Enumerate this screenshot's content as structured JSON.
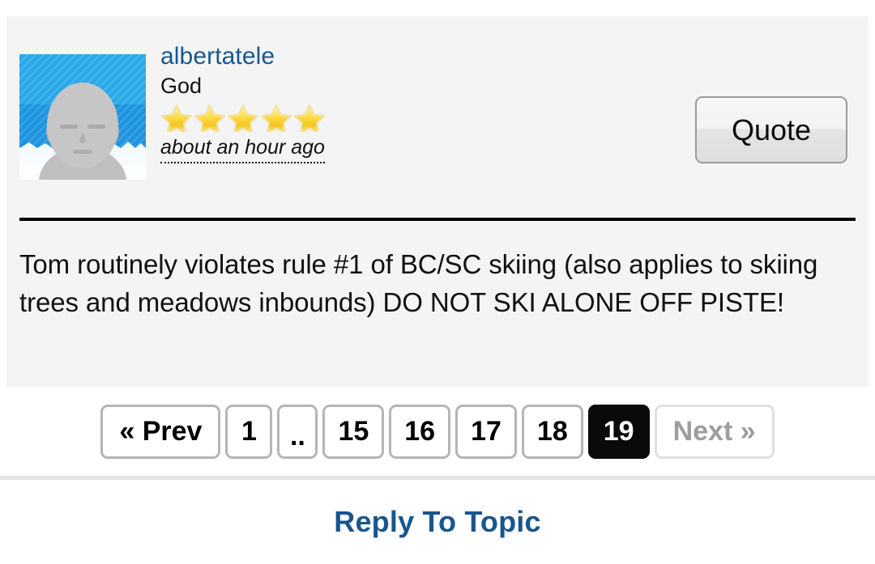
{
  "post": {
    "author": "albertatele",
    "rank": "God",
    "star_count": 5,
    "timestamp": "about an hour ago",
    "quote_label": "Quote",
    "body": "Tom routinely violates rule #1 of BC/SC skiing (also applies to skiing trees and meadows inbounds) DO NOT SKI ALONE OFF PISTE!",
    "avatar_alt": "default-user-avatar"
  },
  "pagination": {
    "items": [
      {
        "label": "« Prev",
        "state": "normal",
        "kind": "prev"
      },
      {
        "label": "1",
        "state": "normal",
        "kind": "page"
      },
      {
        "label": "..",
        "state": "normal",
        "kind": "ellipsis"
      },
      {
        "label": "15",
        "state": "normal",
        "kind": "page"
      },
      {
        "label": "16",
        "state": "normal",
        "kind": "page"
      },
      {
        "label": "17",
        "state": "normal",
        "kind": "page"
      },
      {
        "label": "18",
        "state": "normal",
        "kind": "page"
      },
      {
        "label": "19",
        "state": "active",
        "kind": "page"
      },
      {
        "label": "Next »",
        "state": "disabled",
        "kind": "next"
      }
    ],
    "current_page": "19"
  },
  "footer": {
    "reply_label": "Reply To Topic"
  },
  "colors": {
    "link_blue": "#19578f",
    "reply_blue": "#19558e",
    "panel_bg": "#f4f4f4",
    "page_bg": "#ffffff",
    "active_page_bg": "#0a0a0a",
    "star_gold": "#f6d033",
    "divider_black": "#000000",
    "separator_gray": "#e3e3e3",
    "disabled_gray": "#9d9d9d",
    "avatar_sky": "#2aa9e8",
    "avatar_sky_dark": "#1e95e0",
    "avatar_figure": "#bfbfbf"
  }
}
